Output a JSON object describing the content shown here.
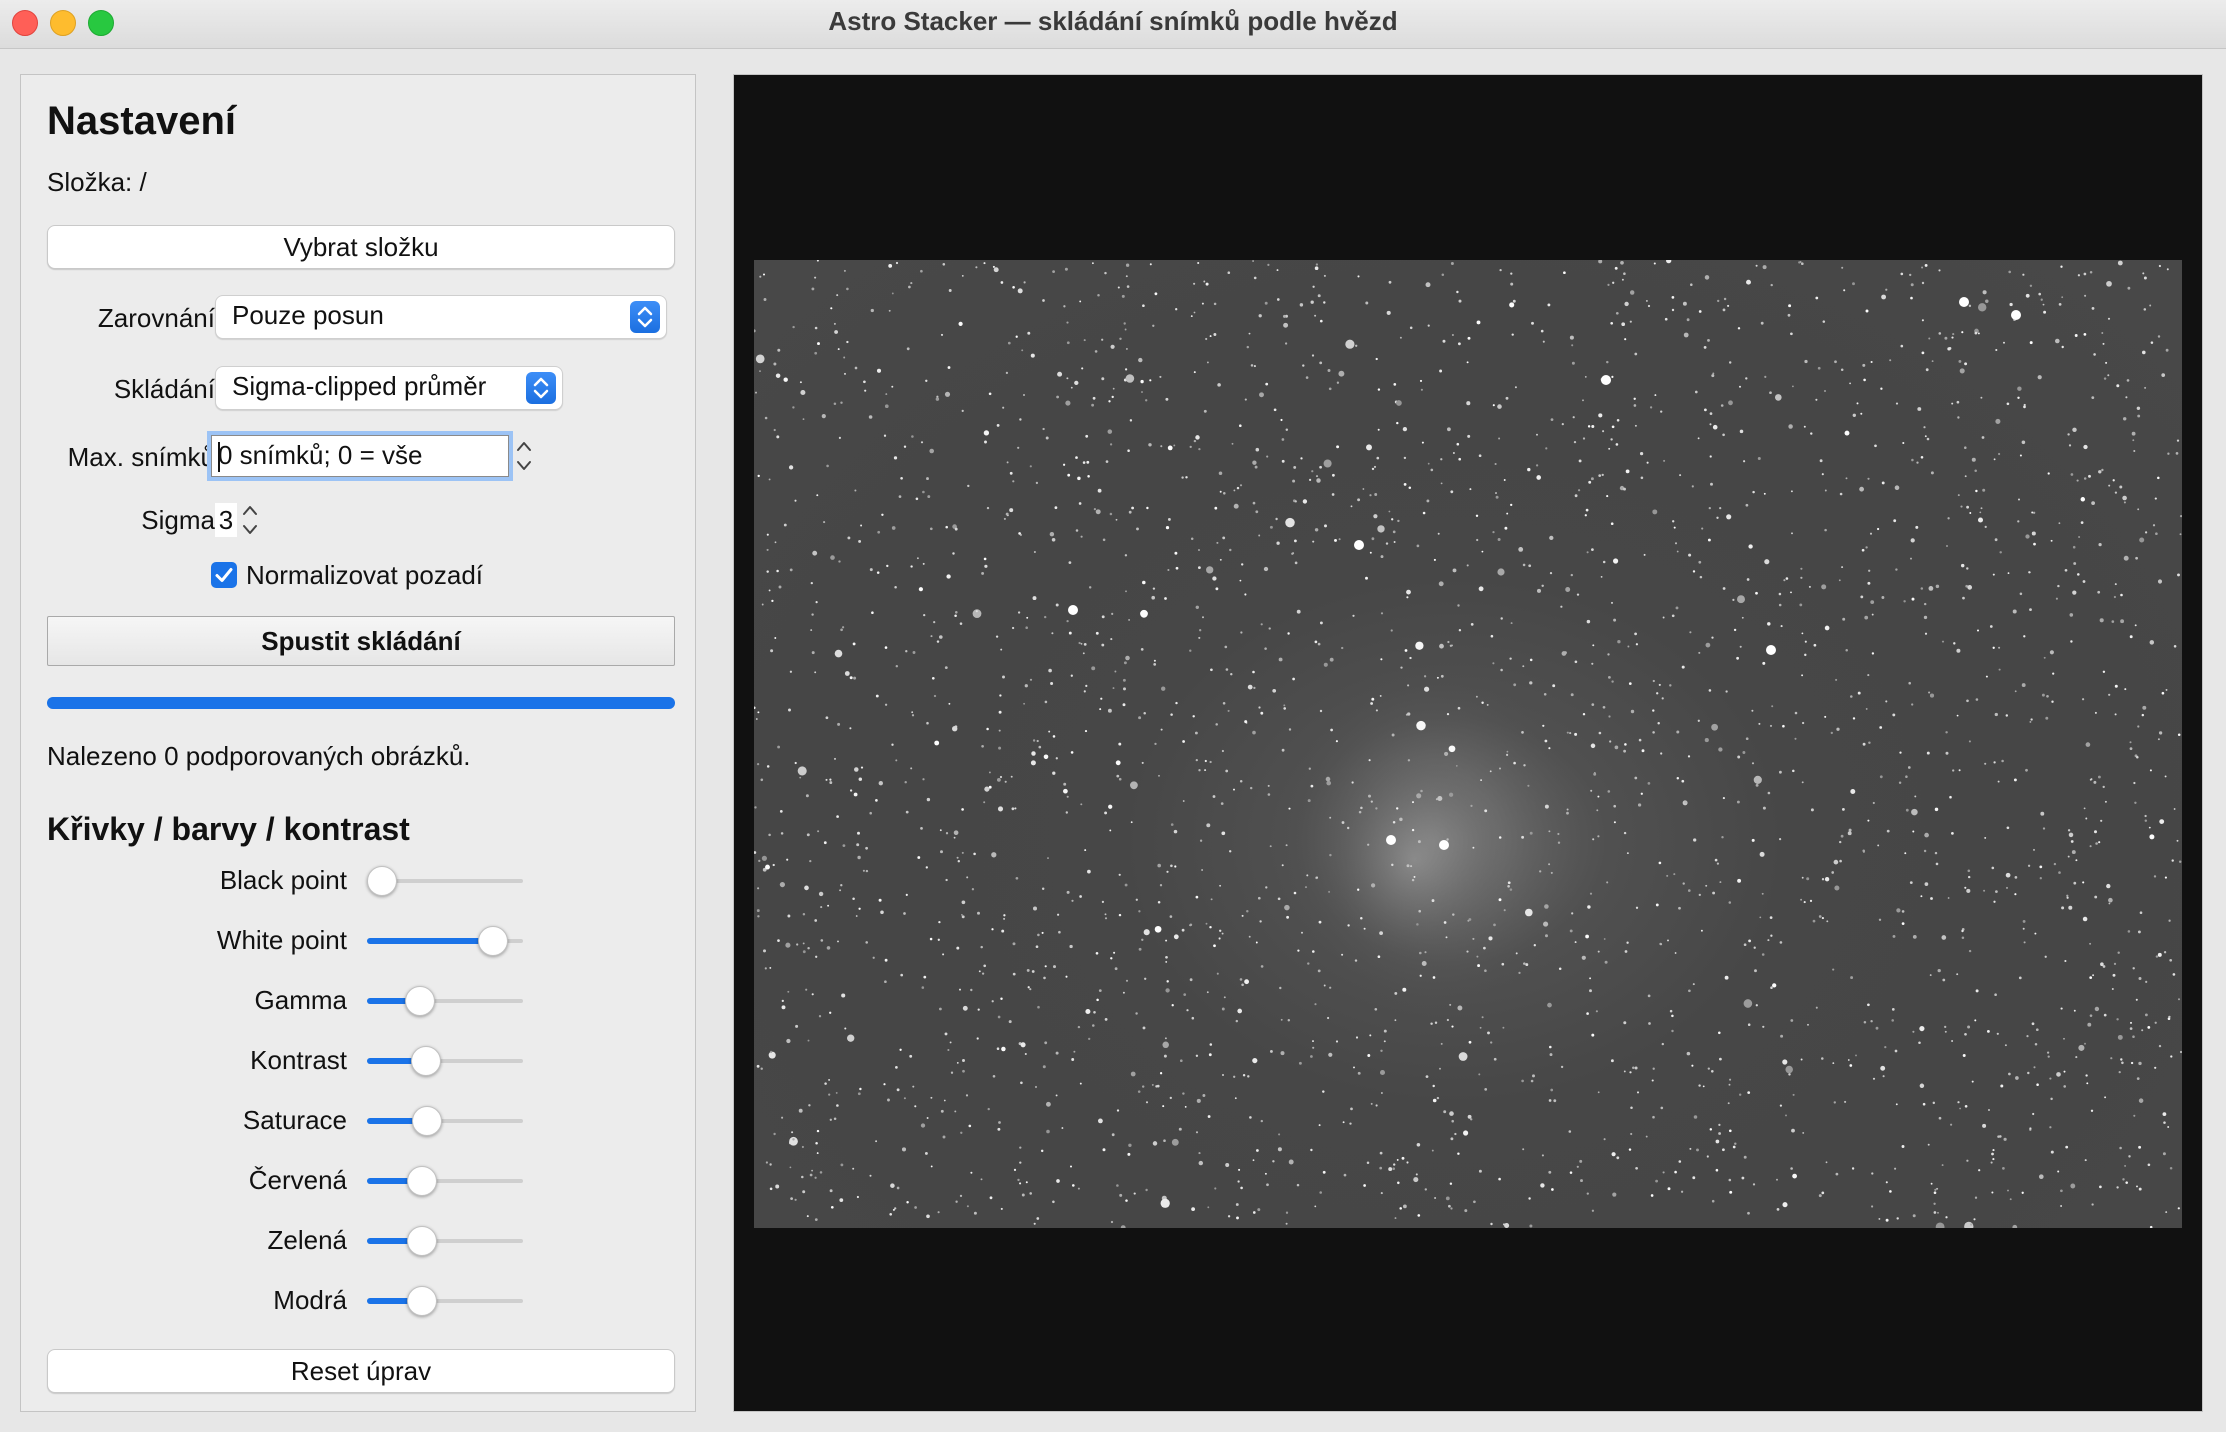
{
  "window": {
    "title": "Astro Stacker — skládání snímků podle hvězd"
  },
  "settings": {
    "title": "Nastavení",
    "folder_label": "Složka: /",
    "choose_folder_button": "Vybrat složku",
    "alignment": {
      "label": "Zarovnání",
      "value": "Pouze posun"
    },
    "stacking": {
      "label": "Skládání",
      "value": "Sigma-clipped průměr"
    },
    "max_frames": {
      "label": "Max. snímků",
      "value": "0 snímků; 0 = vše"
    },
    "sigma": {
      "label": "Sigma",
      "value": "3"
    },
    "normalize_background": {
      "label": "Normalizovat pozadí",
      "checked": true
    },
    "start_button": "Spustit skládání",
    "progress": 1.0,
    "status": "Nalezeno 0 podporovaných obrázků."
  },
  "adjustments": {
    "title": "Křivky / barvy / kontrast",
    "sliders": [
      {
        "label": "Black point",
        "value": 0.0
      },
      {
        "label": "White point",
        "value": 0.88
      },
      {
        "label": "Gamma",
        "value": 0.3
      },
      {
        "label": "Kontrast",
        "value": 0.35
      },
      {
        "label": "Saturace",
        "value": 0.36
      },
      {
        "label": "Červená",
        "value": 0.32
      },
      {
        "label": "Zelená",
        "value": 0.32
      },
      {
        "label": "Modrá",
        "value": 0.32
      }
    ],
    "reset_button": "Reset úprav"
  },
  "colors": {
    "accent": "#1a73e8",
    "viewer_background": "#111111",
    "image_sky": "#474747"
  }
}
